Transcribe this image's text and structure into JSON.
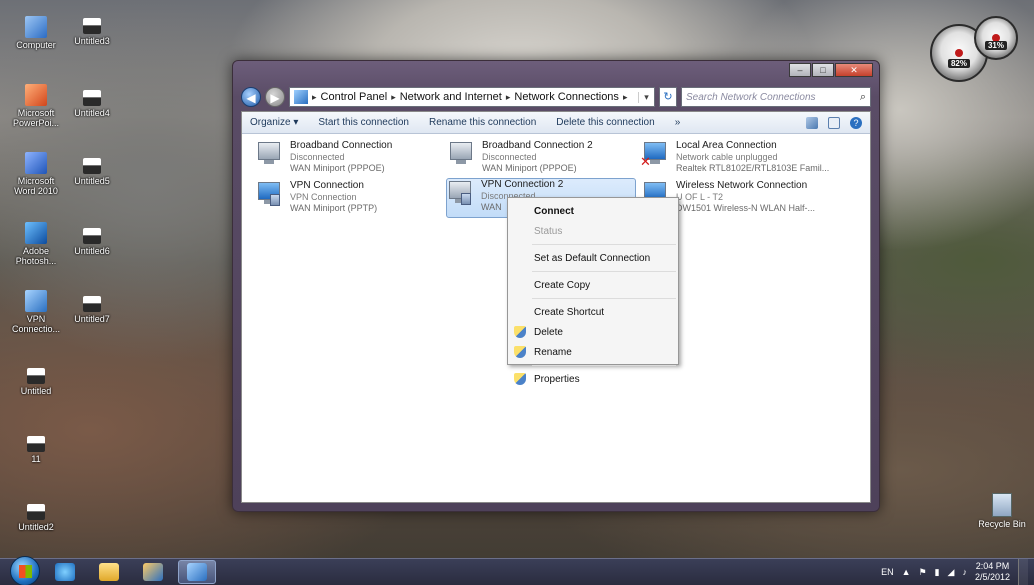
{
  "desktop": {
    "icons": [
      {
        "label": "Computer",
        "type": "comp"
      },
      {
        "label": "Untitled3",
        "type": "file"
      },
      {
        "label": "Microsoft PowerPoi...",
        "type": "ppt"
      },
      {
        "label": "Untitled4",
        "type": "file"
      },
      {
        "label": "Microsoft Word 2010",
        "type": "word"
      },
      {
        "label": "Untitled5",
        "type": "file"
      },
      {
        "label": "Adobe Photosh...",
        "type": "ps"
      },
      {
        "label": "Untitled6",
        "type": "file"
      },
      {
        "label": "VPN Connectio...",
        "type": "vpn"
      },
      {
        "label": "Untitled7",
        "type": "file"
      },
      {
        "label": "Untitled",
        "type": "file"
      },
      {
        "label": "11",
        "type": "file"
      },
      {
        "label": "Untitled2",
        "type": "file"
      }
    ],
    "recycle_bin": "Recycle Bin",
    "gadget": {
      "cpu": "82%",
      "mem": "31%"
    }
  },
  "window": {
    "caption": {
      "min": "–",
      "max": "□",
      "close": "✕"
    },
    "address": {
      "crumbs": [
        "Control Panel",
        "Network and Internet",
        "Network Connections"
      ],
      "separator": "▸"
    },
    "search_placeholder": "Search Network Connections",
    "toolbar": {
      "organize": "Organize ▾",
      "start": "Start this connection",
      "rename": "Rename this connection",
      "delete": "Delete this connection",
      "more": "»"
    },
    "connections": [
      {
        "name": "Broadband Connection",
        "status": "Disconnected",
        "device": "WAN Miniport (PPPOE)"
      },
      {
        "name": "Broadband Connection 2",
        "status": "Disconnected",
        "device": "WAN Miniport (PPPOE)"
      },
      {
        "name": "Local Area Connection",
        "status": "Network cable unplugged",
        "device": "Realtek RTL8102E/RTL8103E Famil..."
      },
      {
        "name": "VPN Connection",
        "status": "VPN Connection",
        "device": "WAN Miniport (PPTP)"
      },
      {
        "name": "VPN Connection 2",
        "status": "Disconnected",
        "device": "WAN"
      },
      {
        "name": "Wireless Network Connection",
        "status": "U OF L - T2",
        "device": "DW1501 Wireless-N WLAN Half-..."
      }
    ]
  },
  "context_menu": {
    "connect": "Connect",
    "status": "Status",
    "set_default": "Set as Default Connection",
    "create_copy": "Create Copy",
    "create_shortcut": "Create Shortcut",
    "delete": "Delete",
    "rename": "Rename",
    "properties": "Properties"
  },
  "taskbar": {
    "lang": "EN",
    "time": "2:04 PM",
    "date": "2/5/2012"
  }
}
